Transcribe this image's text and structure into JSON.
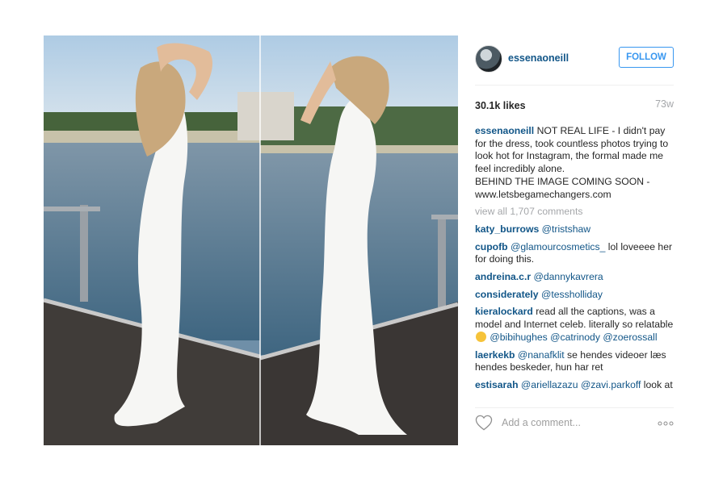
{
  "post": {
    "author": "essenaoneill",
    "follow_label": "FOLLOW",
    "likes": "30.1k likes",
    "time_ago": "73w",
    "caption": {
      "user": "essenaoneill",
      "text": "NOT REAL LIFE - I didn't pay for the dress, took countless photos trying to look hot for Instagram, the formal made me feel incredibly alone.",
      "text2": "BEHIND THE IMAGE COMING SOON - www.letsbegamechangers.com"
    },
    "view_all": "view all 1,707 comments",
    "comments": [
      {
        "user": "katy_burrows",
        "mention": "@tristshaw",
        "text": ""
      },
      {
        "user": "cupofb",
        "mention": "@glamourcosmetics_",
        "text": " lol loveeee her for doing this."
      },
      {
        "user": "andreina.c.r",
        "mention": "@dannykavrera",
        "text": ""
      },
      {
        "user": "considerately",
        "mention": "@tessholliday",
        "text": ""
      },
      {
        "user": "kieralockard",
        "text": "read all the captions, was a model and Internet celeb. literally so relatable",
        "mentions": "@bibihughes @catrinody @zoerossall"
      },
      {
        "user": "laerkekb",
        "mention": "@nanafklit",
        "text": " se hendes videoer læs hendes beskeder, hun har ret"
      },
      {
        "user": "estisarah",
        "mention": "@ariellazazu @zavi.parkoff",
        "text": " look at"
      }
    ],
    "add_comment_placeholder": "Add a comment...",
    "icons": {
      "like": "heart-icon",
      "more": "more-options-icon"
    },
    "colors": {
      "link": "#125688",
      "follow": "#3897f0",
      "muted": "#a5a7aa"
    }
  }
}
